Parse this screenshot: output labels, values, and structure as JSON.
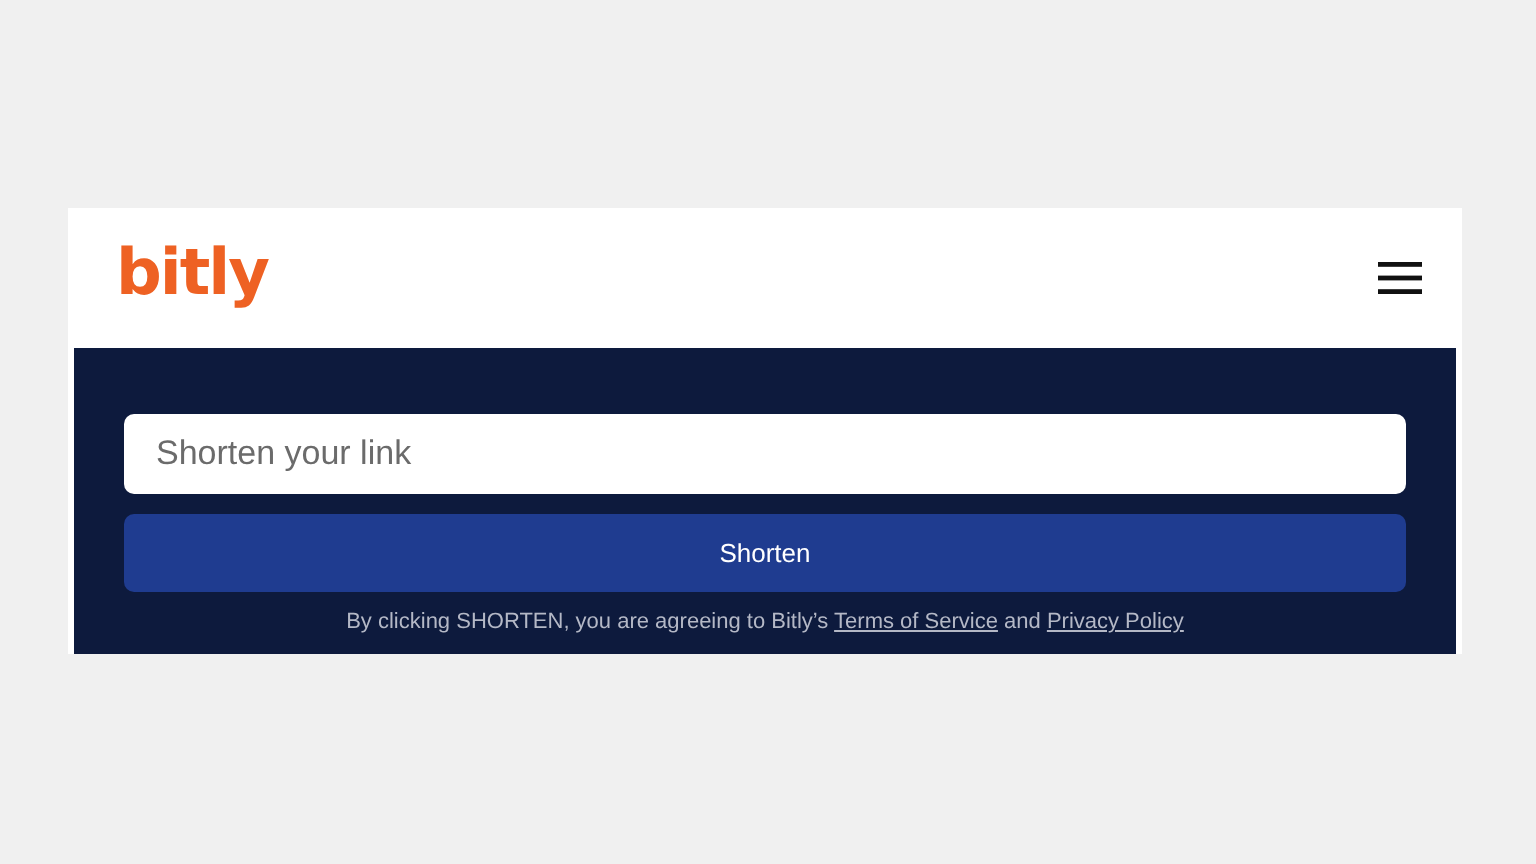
{
  "header": {
    "logo": "bitly"
  },
  "form": {
    "placeholder": "Shorten your link",
    "button": "Shorten"
  },
  "consent": {
    "text": "By clicking SHORTEN, you are agreeing to Bitly’s ",
    "links": [
      {
        "label": "Terms of Service",
        "after": " and "
      },
      {
        "label": "Privacy Policy"
      }
    ]
  }
}
